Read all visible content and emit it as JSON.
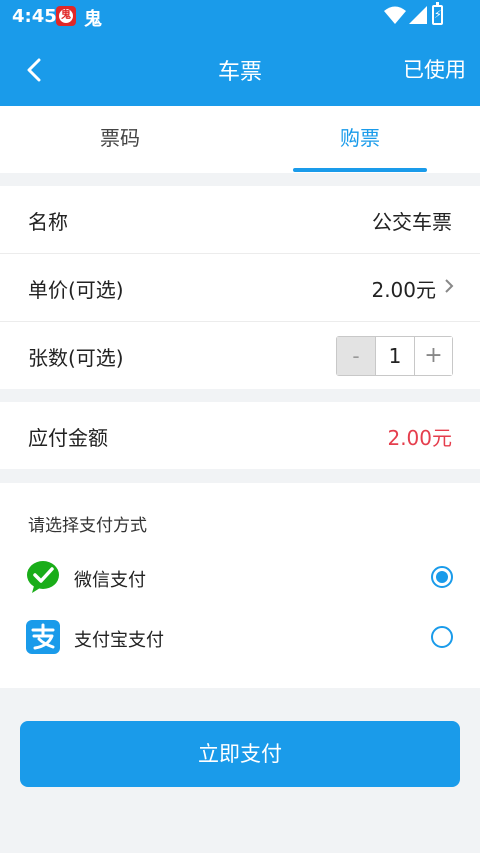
{
  "status_bar": {
    "time": "4:45",
    "app_icon_glyph": "鬼",
    "app_icon2_glyph": "鬼"
  },
  "app_bar": {
    "title": "车票",
    "action": "已使用"
  },
  "tabs": [
    {
      "label": "票码",
      "active": false
    },
    {
      "label": "购票",
      "active": true
    }
  ],
  "details": {
    "name_label": "名称",
    "name_value": "公交车票",
    "price_label": "单价(可选)",
    "price_value": "2.00元",
    "quantity_label": "张数(可选)",
    "quantity": "1",
    "minus": "-",
    "plus": "+"
  },
  "amount": {
    "label": "应付金额",
    "value": "2.00元"
  },
  "payment": {
    "title": "请选择支付方式",
    "options": [
      {
        "label": "微信支付",
        "selected": true,
        "icon": "wechat-pay-icon"
      },
      {
        "label": "支付宝支付",
        "selected": false,
        "icon": "alipay-icon"
      }
    ]
  },
  "pay_button": "立即支付",
  "colors": {
    "primary": "#1a9bea",
    "amount": "#e53e4d",
    "wechat": "#1aad19"
  }
}
